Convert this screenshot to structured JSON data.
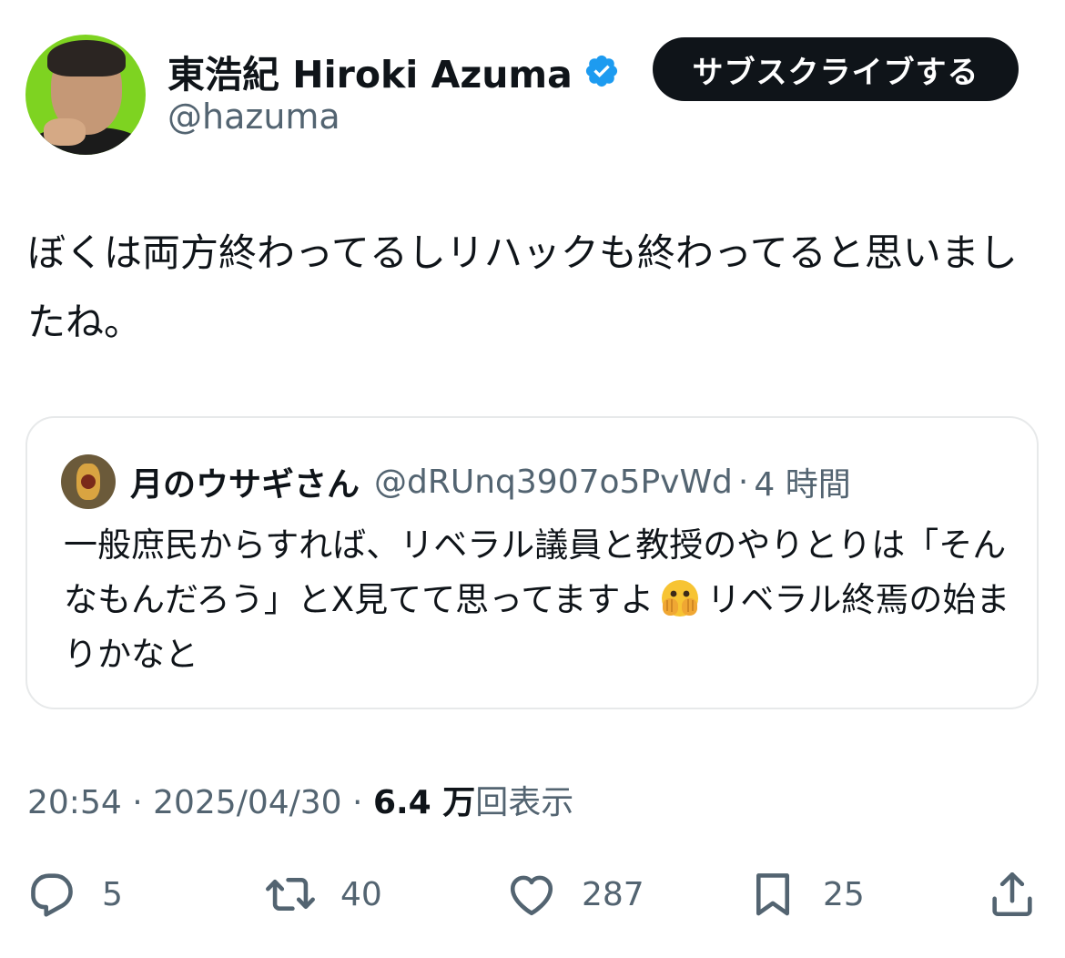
{
  "author": {
    "display_name": "東浩紀 Hiroki Azuma",
    "handle": "@hazuma",
    "verified": true
  },
  "subscribe_button": "サブスクライブする",
  "tweet": {
    "text": "ぼくは両方終わってるしリハックも終わってると思いましたね。"
  },
  "quoted_tweet": {
    "display_name": "月のウサギさん",
    "handle": "@dRUnq3907o5PvWd",
    "separator": "·",
    "time": "4 時間",
    "text_before_emoji": "一般庶民からすれば、リベラル議員と教授のやりとりは「そんなもんだろう」とX見てて思ってますよ",
    "emoji_icon": "face-with-open-eyes-and-hand-over-mouth",
    "text_after_emoji": "リベラル終焉の始まりかなと"
  },
  "meta": {
    "time": "20:54",
    "dot1": " · ",
    "date": "2025/04/30",
    "dot2": " · ",
    "views_count": "6.4 万",
    "views_label": "回表示"
  },
  "actions": {
    "reply_count": "5",
    "retweet_count": "40",
    "like_count": "287",
    "bookmark_count": "25"
  },
  "colors": {
    "text": "#0f1419",
    "secondary": "#536471",
    "verified": "#1d9bf0",
    "border": "#e7e9ea"
  }
}
